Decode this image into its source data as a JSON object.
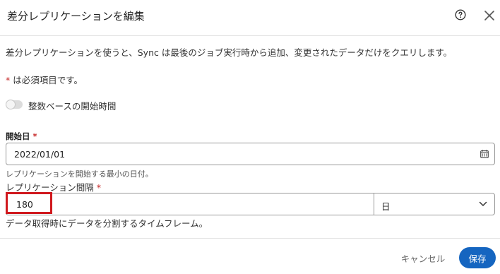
{
  "dialog": {
    "title": "差分レプリケーションを編集",
    "help_icon": "help-circle-icon",
    "close_icon": "close-icon"
  },
  "description": "差分レプリケーションを使うと、Sync は最後のジョブ実行時から追加、変更されたデータだけをクエリします。",
  "required_note": {
    "marker": "*",
    "text": " は必須項目です。"
  },
  "integer_toggle": {
    "label": "整数ベースの開始時間",
    "enabled": false
  },
  "start_date": {
    "label": "開始日",
    "required_marker": "*",
    "value": "2022/01/01",
    "hint": "レプリケーションを開始する最小の日付。",
    "icon": "calendar-icon"
  },
  "interval": {
    "label": "レプリケーション間隔",
    "required_marker": "*",
    "value": "180",
    "unit": "日",
    "hint": "データ取得時にデータを分割するタイムフレーム。",
    "icon": "chevron-down-icon"
  },
  "footer": {
    "cancel_label": "キャンセル",
    "save_label": "保存"
  },
  "colors": {
    "primary": "#1565c0",
    "required": "#c62828",
    "highlight": "#d0191e",
    "border": "#9a9a9a",
    "divider": "#e4e4e4"
  }
}
